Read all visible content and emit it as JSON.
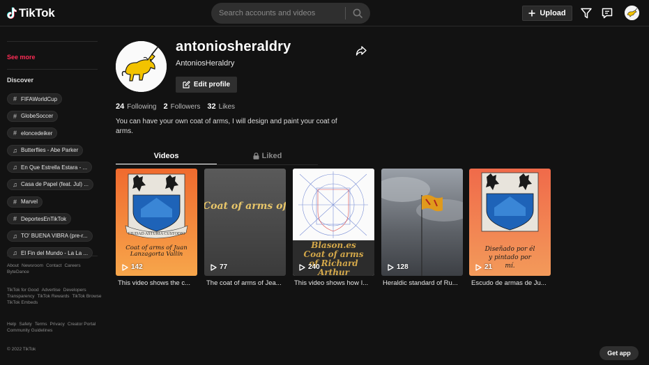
{
  "header": {
    "logo_text": "TikTok",
    "search_placeholder": "Search accounts and videos",
    "upload_label": "Upload"
  },
  "sidebar": {
    "see_more": "See more",
    "discover_title": "Discover",
    "tags": [
      {
        "icon": "hashtag-icon",
        "label": "FIFAWorldCup"
      },
      {
        "icon": "hashtag-icon",
        "label": "GlobeSoccer"
      },
      {
        "icon": "hashtag-icon",
        "label": "eloncedeiker"
      },
      {
        "icon": "music-note-icon",
        "label": "Butterflies - Abe Parker"
      },
      {
        "icon": "music-note-icon",
        "label": "En Que Estrella Estara - ..."
      },
      {
        "icon": "music-note-icon",
        "label": "Casa de Papel (feat. Jul) ..."
      },
      {
        "icon": "hashtag-icon",
        "label": "Marvel"
      },
      {
        "icon": "hashtag-icon",
        "label": "DeportesEnTikTok"
      },
      {
        "icon": "music-note-icon",
        "label": "TO' BUENA VIBRA (pre-r..."
      },
      {
        "icon": "music-note-icon",
        "label": "El Fin del Mundo - La La ..."
      }
    ],
    "footer": {
      "row1": [
        "About",
        "Newsroom",
        "Contact",
        "Careers",
        "ByteDance"
      ],
      "row2": [
        "TikTok for Good",
        "Advertise",
        "Developers",
        "Transparency",
        "TikTok Rewards",
        "TikTok Browse",
        "TikTok Embeds"
      ],
      "row3": [
        "Help",
        "Safety",
        "Terms",
        "Privacy",
        "Creator Portal",
        "Community Guidelines"
      ],
      "copyright": "© 2022 TikTok"
    }
  },
  "profile": {
    "username": "antoniosheraldry",
    "nickname": "AntoniosHeraldry",
    "edit_label": "Edit profile",
    "following_count": "24",
    "following_label": "Following",
    "followers_count": "2",
    "followers_label": "Followers",
    "likes_count": "32",
    "likes_label": "Likes",
    "bio": "You can have your own coat of arms, I will design and paint your coat of arms."
  },
  "tabs": {
    "videos": "Videos",
    "liked": "Liked"
  },
  "videos": [
    {
      "views": "142",
      "caption": "This video shows the c...",
      "thumb_text": "Coat of arms of Juan Lanzagorta Vallín",
      "banner_text": "CIUDAD ASTURIA CUSTODIO"
    },
    {
      "views": "77",
      "caption": "The coat of arms of Jea...",
      "thumb_text": "Coat of arms of istophe Loubet constructive meth"
    },
    {
      "views": "240",
      "caption": "This video shows how I...",
      "thumb_text": "Blason.es Coat of arms of Richard Arthur"
    },
    {
      "views": "128",
      "caption": "Heraldic standard of Ru..."
    },
    {
      "views": "21",
      "caption": "Escudo de armas de Ju...",
      "thumb_text": "Diseñado por él y pintado por mí."
    }
  ],
  "get_app": "Get app",
  "colors": {
    "accent": "#fe2c55",
    "background": "#121212",
    "card": "#2f2f2f"
  }
}
